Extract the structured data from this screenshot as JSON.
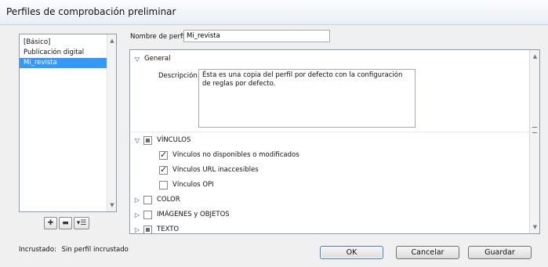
{
  "window": {
    "title": "Perfiles de comprobación preliminar"
  },
  "profiles": {
    "items": [
      {
        "label": "[Básico]",
        "selected": false
      },
      {
        "label": "Publicación digital",
        "selected": false
      },
      {
        "label": "Mi_revista",
        "selected": true
      }
    ]
  },
  "profile_name": {
    "label": "Nombre de perfil:",
    "value": "Mi_revista"
  },
  "general": {
    "label": "General",
    "description_label": "Descripción:",
    "description_value": "Ésta es una copia del perfil por defecto con la configuración de reglas por defecto."
  },
  "sections": {
    "vinculos": {
      "label": "VÍNCULOS",
      "items": [
        {
          "label": "Vínculos no disponibles o modificados",
          "checked": true
        },
        {
          "label": "Vínculos URL inaccesibles",
          "checked": true
        },
        {
          "label": "Vínculos OPI",
          "checked": false
        }
      ]
    },
    "color": {
      "label": "COLOR"
    },
    "imagenes": {
      "label": "IMÁGENES y OBJETOS"
    },
    "texto": {
      "label": "TEXTO"
    }
  },
  "status": {
    "label": "Incrustado:",
    "value": "Sin perfil incrustado"
  },
  "buttons": {
    "ok": "OK",
    "cancel": "Cancelar",
    "save": "Guardar"
  },
  "icons": {
    "new_profile": "plus-icon",
    "delete_profile": "minus-icon",
    "profile_menu": "menu-icon"
  },
  "colors": {
    "selection": "#3399ff",
    "panel_border": "#8d9aa8"
  }
}
